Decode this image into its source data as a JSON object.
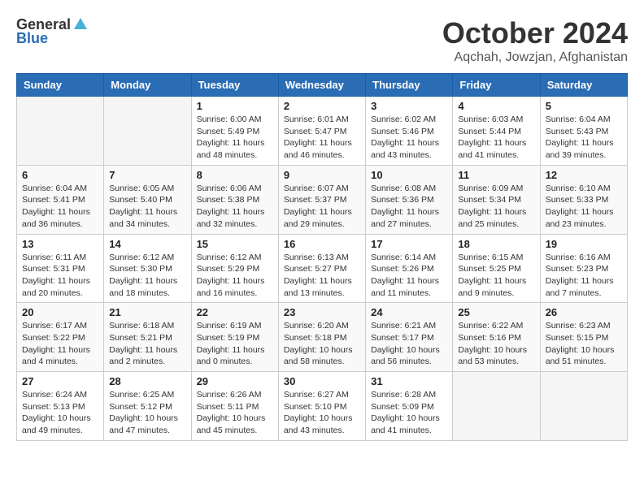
{
  "header": {
    "logo_general": "General",
    "logo_blue": "Blue",
    "month": "October 2024",
    "location": "Aqchah, Jowzjan, Afghanistan"
  },
  "weekdays": [
    "Sunday",
    "Monday",
    "Tuesday",
    "Wednesday",
    "Thursday",
    "Friday",
    "Saturday"
  ],
  "weeks": [
    [
      {
        "day": "",
        "sunrise": "",
        "sunset": "",
        "daylight": ""
      },
      {
        "day": "",
        "sunrise": "",
        "sunset": "",
        "daylight": ""
      },
      {
        "day": "1",
        "sunrise": "Sunrise: 6:00 AM",
        "sunset": "Sunset: 5:49 PM",
        "daylight": "Daylight: 11 hours and 48 minutes."
      },
      {
        "day": "2",
        "sunrise": "Sunrise: 6:01 AM",
        "sunset": "Sunset: 5:47 PM",
        "daylight": "Daylight: 11 hours and 46 minutes."
      },
      {
        "day": "3",
        "sunrise": "Sunrise: 6:02 AM",
        "sunset": "Sunset: 5:46 PM",
        "daylight": "Daylight: 11 hours and 43 minutes."
      },
      {
        "day": "4",
        "sunrise": "Sunrise: 6:03 AM",
        "sunset": "Sunset: 5:44 PM",
        "daylight": "Daylight: 11 hours and 41 minutes."
      },
      {
        "day": "5",
        "sunrise": "Sunrise: 6:04 AM",
        "sunset": "Sunset: 5:43 PM",
        "daylight": "Daylight: 11 hours and 39 minutes."
      }
    ],
    [
      {
        "day": "6",
        "sunrise": "Sunrise: 6:04 AM",
        "sunset": "Sunset: 5:41 PM",
        "daylight": "Daylight: 11 hours and 36 minutes."
      },
      {
        "day": "7",
        "sunrise": "Sunrise: 6:05 AM",
        "sunset": "Sunset: 5:40 PM",
        "daylight": "Daylight: 11 hours and 34 minutes."
      },
      {
        "day": "8",
        "sunrise": "Sunrise: 6:06 AM",
        "sunset": "Sunset: 5:38 PM",
        "daylight": "Daylight: 11 hours and 32 minutes."
      },
      {
        "day": "9",
        "sunrise": "Sunrise: 6:07 AM",
        "sunset": "Sunset: 5:37 PM",
        "daylight": "Daylight: 11 hours and 29 minutes."
      },
      {
        "day": "10",
        "sunrise": "Sunrise: 6:08 AM",
        "sunset": "Sunset: 5:36 PM",
        "daylight": "Daylight: 11 hours and 27 minutes."
      },
      {
        "day": "11",
        "sunrise": "Sunrise: 6:09 AM",
        "sunset": "Sunset: 5:34 PM",
        "daylight": "Daylight: 11 hours and 25 minutes."
      },
      {
        "day": "12",
        "sunrise": "Sunrise: 6:10 AM",
        "sunset": "Sunset: 5:33 PM",
        "daylight": "Daylight: 11 hours and 23 minutes."
      }
    ],
    [
      {
        "day": "13",
        "sunrise": "Sunrise: 6:11 AM",
        "sunset": "Sunset: 5:31 PM",
        "daylight": "Daylight: 11 hours and 20 minutes."
      },
      {
        "day": "14",
        "sunrise": "Sunrise: 6:12 AM",
        "sunset": "Sunset: 5:30 PM",
        "daylight": "Daylight: 11 hours and 18 minutes."
      },
      {
        "day": "15",
        "sunrise": "Sunrise: 6:12 AM",
        "sunset": "Sunset: 5:29 PM",
        "daylight": "Daylight: 11 hours and 16 minutes."
      },
      {
        "day": "16",
        "sunrise": "Sunrise: 6:13 AM",
        "sunset": "Sunset: 5:27 PM",
        "daylight": "Daylight: 11 hours and 13 minutes."
      },
      {
        "day": "17",
        "sunrise": "Sunrise: 6:14 AM",
        "sunset": "Sunset: 5:26 PM",
        "daylight": "Daylight: 11 hours and 11 minutes."
      },
      {
        "day": "18",
        "sunrise": "Sunrise: 6:15 AM",
        "sunset": "Sunset: 5:25 PM",
        "daylight": "Daylight: 11 hours and 9 minutes."
      },
      {
        "day": "19",
        "sunrise": "Sunrise: 6:16 AM",
        "sunset": "Sunset: 5:23 PM",
        "daylight": "Daylight: 11 hours and 7 minutes."
      }
    ],
    [
      {
        "day": "20",
        "sunrise": "Sunrise: 6:17 AM",
        "sunset": "Sunset: 5:22 PM",
        "daylight": "Daylight: 11 hours and 4 minutes."
      },
      {
        "day": "21",
        "sunrise": "Sunrise: 6:18 AM",
        "sunset": "Sunset: 5:21 PM",
        "daylight": "Daylight: 11 hours and 2 minutes."
      },
      {
        "day": "22",
        "sunrise": "Sunrise: 6:19 AM",
        "sunset": "Sunset: 5:19 PM",
        "daylight": "Daylight: 11 hours and 0 minutes."
      },
      {
        "day": "23",
        "sunrise": "Sunrise: 6:20 AM",
        "sunset": "Sunset: 5:18 PM",
        "daylight": "Daylight: 10 hours and 58 minutes."
      },
      {
        "day": "24",
        "sunrise": "Sunrise: 6:21 AM",
        "sunset": "Sunset: 5:17 PM",
        "daylight": "Daylight: 10 hours and 56 minutes."
      },
      {
        "day": "25",
        "sunrise": "Sunrise: 6:22 AM",
        "sunset": "Sunset: 5:16 PM",
        "daylight": "Daylight: 10 hours and 53 minutes."
      },
      {
        "day": "26",
        "sunrise": "Sunrise: 6:23 AM",
        "sunset": "Sunset: 5:15 PM",
        "daylight": "Daylight: 10 hours and 51 minutes."
      }
    ],
    [
      {
        "day": "27",
        "sunrise": "Sunrise: 6:24 AM",
        "sunset": "Sunset: 5:13 PM",
        "daylight": "Daylight: 10 hours and 49 minutes."
      },
      {
        "day": "28",
        "sunrise": "Sunrise: 6:25 AM",
        "sunset": "Sunset: 5:12 PM",
        "daylight": "Daylight: 10 hours and 47 minutes."
      },
      {
        "day": "29",
        "sunrise": "Sunrise: 6:26 AM",
        "sunset": "Sunset: 5:11 PM",
        "daylight": "Daylight: 10 hours and 45 minutes."
      },
      {
        "day": "30",
        "sunrise": "Sunrise: 6:27 AM",
        "sunset": "Sunset: 5:10 PM",
        "daylight": "Daylight: 10 hours and 43 minutes."
      },
      {
        "day": "31",
        "sunrise": "Sunrise: 6:28 AM",
        "sunset": "Sunset: 5:09 PM",
        "daylight": "Daylight: 10 hours and 41 minutes."
      },
      {
        "day": "",
        "sunrise": "",
        "sunset": "",
        "daylight": ""
      },
      {
        "day": "",
        "sunrise": "",
        "sunset": "",
        "daylight": ""
      }
    ]
  ]
}
